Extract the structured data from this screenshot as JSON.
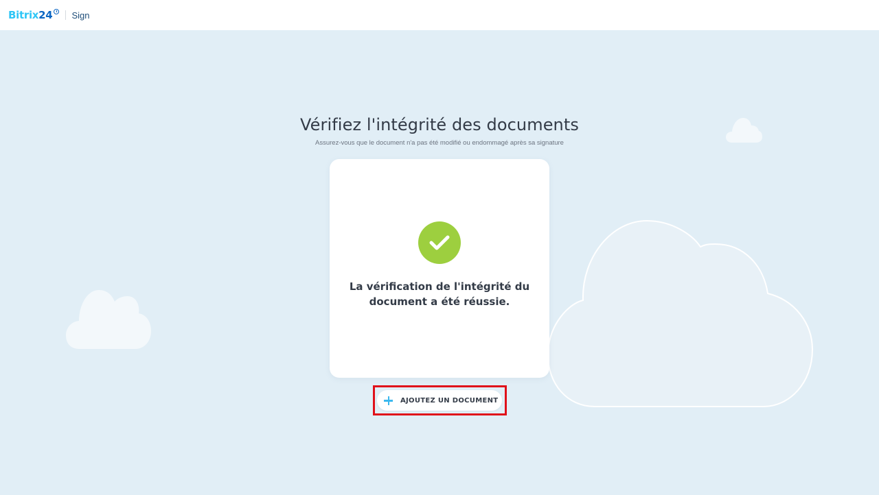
{
  "header": {
    "logo_brand": "Bitrix",
    "logo_number": "24",
    "product": "Sign"
  },
  "main": {
    "title": "Vérifiez l'intégrité des documents",
    "subtitle": "Assurez-vous que le document n'a pas été modifié ou endommagé après sa signature",
    "result_text": "La vérification de l'intégrité du document a été réussie.",
    "add_button_label": "AJOUTEZ UN DOCUMENT"
  },
  "colors": {
    "background": "#e1eef6",
    "brand_light": "#2fc6f6",
    "brand_dark": "#0b66c3",
    "success": "#9dcf3f",
    "highlight": "#e0101a"
  },
  "icons": [
    "clock-icon",
    "check-icon",
    "plus-icon",
    "cloud-icon"
  ]
}
